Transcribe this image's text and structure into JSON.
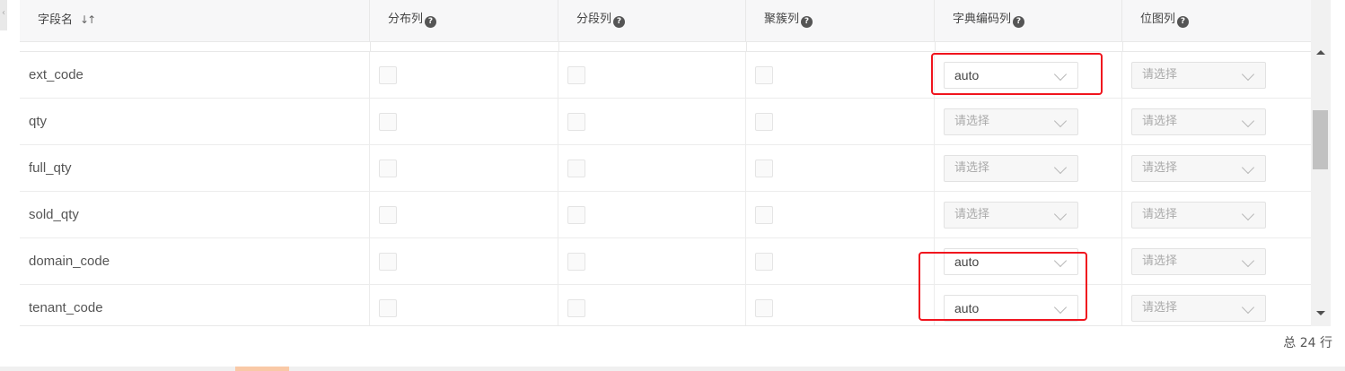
{
  "columns": {
    "field_name": "字段名",
    "distribution": "分布列",
    "segment": "分段列",
    "cluster": "聚簇列",
    "dict_encoding": "字典编码列",
    "bitmap": "位图列"
  },
  "help_glyph": "?",
  "sort_glyph": "↓↑",
  "rows": [
    {
      "name": "ext_code",
      "dict": "auto",
      "bitmap": "请选择"
    },
    {
      "name": "qty",
      "dict": "请选择",
      "bitmap": "请选择"
    },
    {
      "name": "full_qty",
      "dict": "请选择",
      "bitmap": "请选择"
    },
    {
      "name": "sold_qty",
      "dict": "请选择",
      "bitmap": "请选择"
    },
    {
      "name": "domain_code",
      "dict": "auto",
      "bitmap": "请选择"
    },
    {
      "name": "tenant_code",
      "dict": "auto",
      "bitmap": "请选择"
    }
  ],
  "footer": {
    "total": "总 24 行"
  },
  "colors": {
    "highlight": "#f0141e",
    "header_bg": "#f7f7f8"
  }
}
